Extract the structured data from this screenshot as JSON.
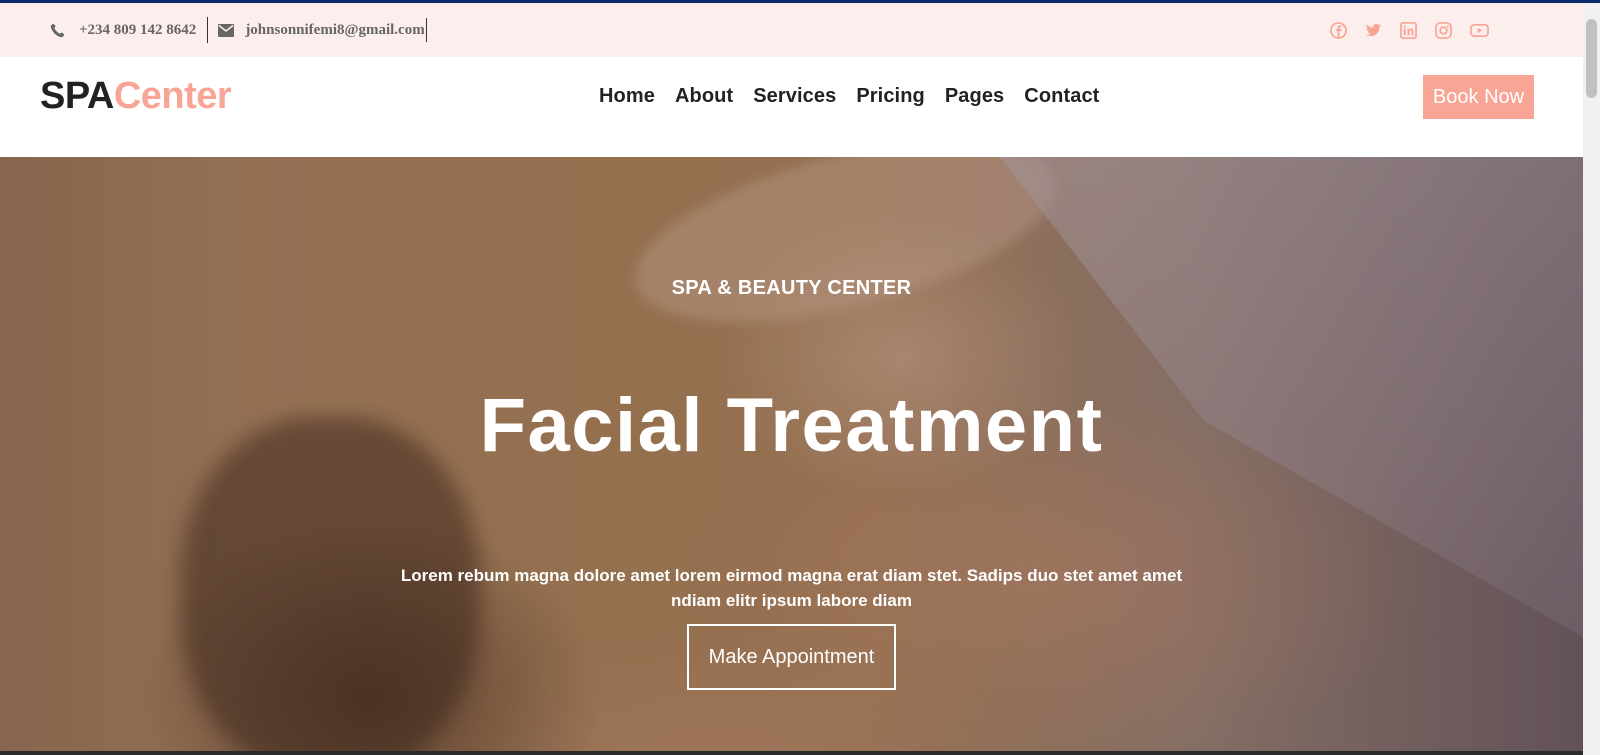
{
  "topbar": {
    "phone": "+234 809 142 8642",
    "email": "johnsonnifemi8@gmail.com",
    "social_icons": [
      "facebook-icon",
      "twitter-icon",
      "linkedin-icon",
      "instagram-icon",
      "youtube-icon"
    ],
    "accent_color": "#f8a595"
  },
  "navbar": {
    "logo_part1": "SPA",
    "logo_part2": "Center",
    "links": [
      "Home",
      "About",
      "Services",
      "Pricing",
      "Pages",
      "Contact"
    ],
    "book_button": "Book Now"
  },
  "hero": {
    "eyebrow": "SPA & BEAUTY CENTER",
    "title": "Facial Treatment",
    "description": "Lorem rebum magna dolore amet lorem eirmod magna erat diam stet. Sadips duo stet amet amet ndiam elitr ipsum labore diam",
    "button": "Make Appointment"
  }
}
